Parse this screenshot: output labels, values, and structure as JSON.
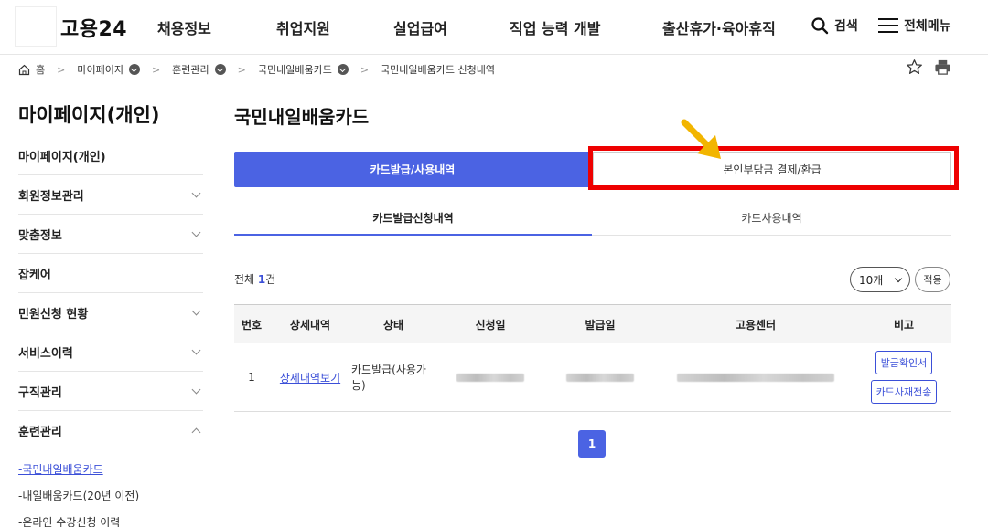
{
  "header": {
    "logo": "고용24",
    "nav": [
      "채용정보",
      "취업지원",
      "실업급여",
      "직업 능력 개발",
      "출산휴가·육아휴직"
    ],
    "search_label": "검색",
    "menu_label": "전체메뉴"
  },
  "breadcrumb": {
    "home": "홈",
    "items": [
      "마이페이지",
      "훈련관리",
      "국민내일배움카드",
      "국민내일배움카드 신청내역"
    ]
  },
  "sidebar": {
    "title": "마이페이지(개인)",
    "items": [
      {
        "label": "마이페이지(개인)"
      },
      {
        "label": "회원정보관리"
      },
      {
        "label": "맞춤정보"
      },
      {
        "label": "잡케어"
      },
      {
        "label": "민원신청 현황"
      },
      {
        "label": "서비스이력"
      },
      {
        "label": "구직관리"
      },
      {
        "label": "훈련관리"
      }
    ],
    "sub_items": [
      "-국민내일배움카드",
      "-내일배움카드(20년 이전)",
      "-온라인 수강신청 이력"
    ]
  },
  "main": {
    "title": "국민내일배움카드",
    "tabs": [
      "카드발급/사용내역",
      "본인부담금 결제/환급"
    ],
    "subtabs": [
      "카드발급신청내역",
      "카드사용내역"
    ],
    "total_prefix": "전체 ",
    "total_count": "1",
    "total_suffix": "건",
    "page_size": "10개",
    "apply_label": "적용",
    "table": {
      "headers": [
        "번호",
        "상세내역",
        "상태",
        "신청일",
        "발급일",
        "고용센터",
        "비고"
      ],
      "row": {
        "no": "1",
        "detail": "상세내역보기",
        "status": "카드발급(사용가능)",
        "btn1": "발급확인서",
        "btn2": "카드사재전송"
      }
    },
    "page": "1"
  },
  "colors": {
    "accent": "#4b63e3",
    "highlight": "#ee0000",
    "arrow": "#f2b500"
  }
}
